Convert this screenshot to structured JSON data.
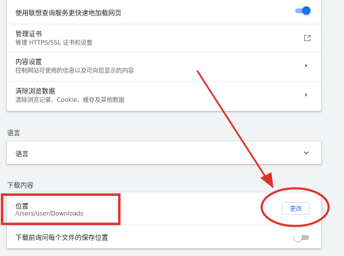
{
  "privacy": {
    "preload": {
      "label": "使用联想查询服务更快速地加载网页",
      "toggle_on": true
    },
    "certificates": {
      "title": "管理证书",
      "subtitle": "管理 HTTPS/SSL 证书和设置",
      "icon": "open-in-new-icon"
    },
    "content_settings": {
      "title": "内容设置",
      "subtitle": "控制网站可使用的信息以及可向您显示的内容",
      "icon": "chevron-right-icon"
    },
    "clear_data": {
      "title": "清除浏览数据",
      "subtitle": "清除浏览记录、Cookie、缓存及其他数据",
      "icon": "chevron-right-icon"
    }
  },
  "languages": {
    "heading": "语言",
    "row_label": "语言",
    "icon": "chevron-down-icon"
  },
  "downloads": {
    "heading": "下载内容",
    "location_title": "位置",
    "location_path": "/Users/user/Downloads",
    "change_button": "更改",
    "ask_label": "下载前询问每个文件的保存位置",
    "ask_toggle_on": false
  },
  "colors": {
    "page_bg": "#f1f3f4",
    "toggle_on_track": "#8ab4f8",
    "toggle_on_knob": "#1a73e8",
    "toggle_off_track": "#bdc1c6",
    "toggle_off_knob": "#ffffff",
    "annotation_red": "#e0302d",
    "link_blue": "#1a73e8"
  }
}
